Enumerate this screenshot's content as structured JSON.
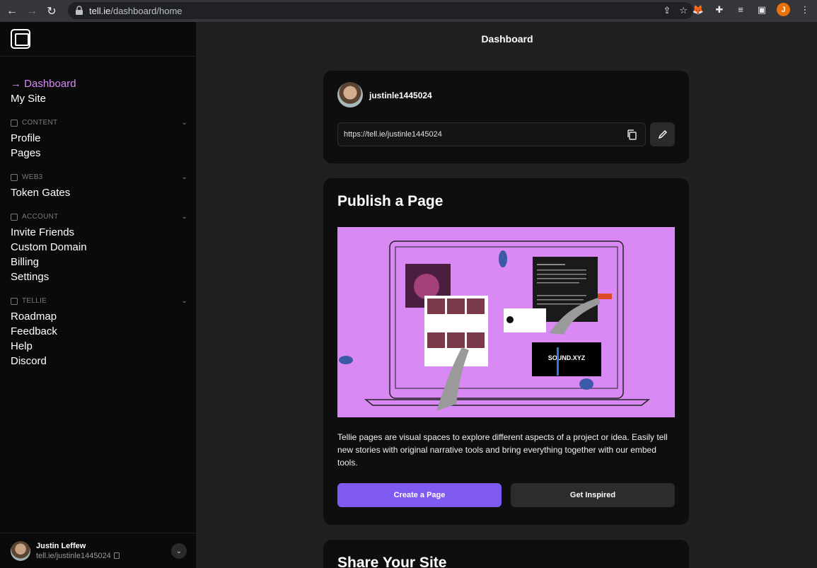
{
  "browser": {
    "url_host": "tell.ie",
    "url_path": "/dashboard/home",
    "profile_initial": "J"
  },
  "sidebar": {
    "primary": [
      {
        "label": "→ Dashboard",
        "active": true
      },
      {
        "label": "My Site",
        "active": false
      }
    ],
    "sections": [
      {
        "title": "CONTENT",
        "items": [
          "Profile",
          "Pages"
        ]
      },
      {
        "title": "WEB3",
        "items": [
          "Token Gates"
        ]
      },
      {
        "title": "ACCOUNT",
        "items": [
          "Invite Friends",
          "Custom Domain",
          "Billing",
          "Settings"
        ]
      },
      {
        "title": "TELLIE",
        "items": [
          "Roadmap",
          "Feedback",
          "Help",
          "Discord"
        ]
      }
    ],
    "footer": {
      "name": "Justin Leffew",
      "handle": "tell.ie/justinle1445024"
    }
  },
  "main": {
    "title": "Dashboard",
    "user_card": {
      "username": "justinle1445024",
      "site_url": "https://tell.ie/justinle1445024"
    },
    "publish": {
      "title": "Publish a Page",
      "description": "Tellie pages are visual spaces to explore different aspects of a project or idea. Easily tell new stories with original narrative tools and bring everything together with our embed tools.",
      "primary_button": "Create a Page",
      "secondary_button": "Get Inspired",
      "illustration": {
        "background": "#d889f3",
        "embed_card_title": "SOUND.XYZ"
      }
    },
    "share": {
      "title": "Share Your Site"
    }
  },
  "colors": {
    "accent_purple": "#7f5af0",
    "active_link": "#d88bf5",
    "illustration_bg": "#d889f3"
  }
}
